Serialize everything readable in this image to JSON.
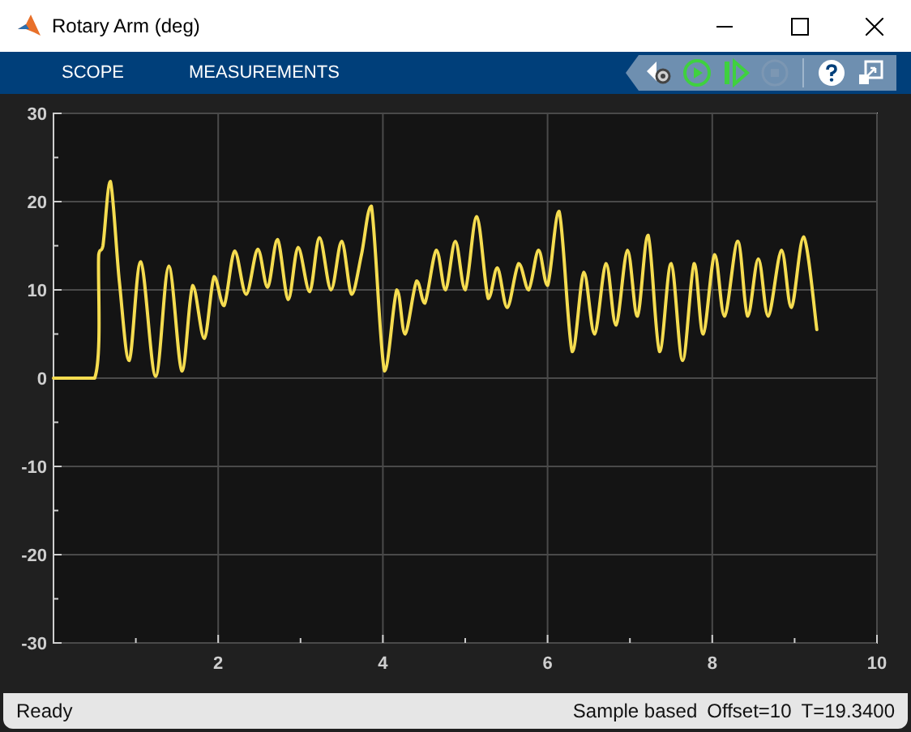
{
  "window": {
    "title": "Rotary Arm (deg)"
  },
  "toolbar": {
    "tabs": [
      {
        "label": "SCOPE"
      },
      {
        "label": "MEASUREMENTS"
      }
    ],
    "controls": [
      {
        "kind": "settings",
        "disabled": false
      },
      {
        "kind": "run",
        "disabled": false
      },
      {
        "kind": "step",
        "disabled": false
      },
      {
        "kind": "stop",
        "disabled": true
      },
      {
        "kind": "separator",
        "disabled": false
      },
      {
        "kind": "help",
        "disabled": false
      },
      {
        "kind": "undock",
        "disabled": false
      }
    ]
  },
  "scope": {
    "chart_data": {
      "type": "line",
      "x": [
        0,
        0.5,
        0.55,
        0.6,
        0.69,
        0.8,
        0.92,
        1.06,
        1.24,
        1.4,
        1.56,
        1.69,
        1.83,
        1.95,
        2.07,
        2.2,
        2.34,
        2.48,
        2.6,
        2.72,
        2.85,
        2.97,
        3.11,
        3.23,
        3.37,
        3.5,
        3.62,
        3.74,
        3.86,
        4.02,
        4.17,
        4.27,
        4.41,
        4.51,
        4.65,
        4.76,
        4.88,
        5.0,
        5.14,
        5.28,
        5.39,
        5.51,
        5.65,
        5.77,
        5.89,
        6.0,
        6.14,
        6.3,
        6.44,
        6.57,
        6.71,
        6.83,
        6.97,
        7.09,
        7.22,
        7.36,
        7.5,
        7.64,
        7.78,
        7.89,
        8.03,
        8.15,
        8.31,
        8.43,
        8.56,
        8.68,
        8.84,
        8.96,
        9.11,
        9.27
      ],
      "series": [
        {
          "color": "#f5dc50",
          "values": [
            0,
            0,
            14,
            15,
            22.3,
            11,
            2,
            13.2,
            0.2,
            12.7,
            0.8,
            10.5,
            4.5,
            11.5,
            8.2,
            14.4,
            9.5,
            14.6,
            10.3,
            15.7,
            8.9,
            14.8,
            9.8,
            15.9,
            10,
            15.5,
            9.5,
            14,
            19.5,
            0.8,
            10,
            5,
            11,
            8.5,
            14.5,
            10,
            15.5,
            10,
            18.3,
            9,
            12.5,
            8,
            13,
            10,
            14.5,
            10.5,
            18.9,
            3,
            12,
            5,
            13,
            6,
            14.5,
            7,
            16.2,
            3,
            13,
            2,
            13,
            5,
            14,
            7,
            15.5,
            7,
            13.5,
            7,
            14.5,
            8,
            16,
            5.5
          ]
        }
      ],
      "grid": true,
      "xlim": [
        0,
        10
      ],
      "ylim": [
        -30,
        30
      ],
      "xticks": [
        2,
        4,
        6,
        8,
        10
      ],
      "yticks": [
        -30,
        -20,
        -10,
        0,
        10,
        20,
        30
      ]
    }
  },
  "status_bar": {
    "message": "Ready",
    "details": [
      "Sample based",
      "Offset=10",
      "T=19.3400"
    ]
  }
}
